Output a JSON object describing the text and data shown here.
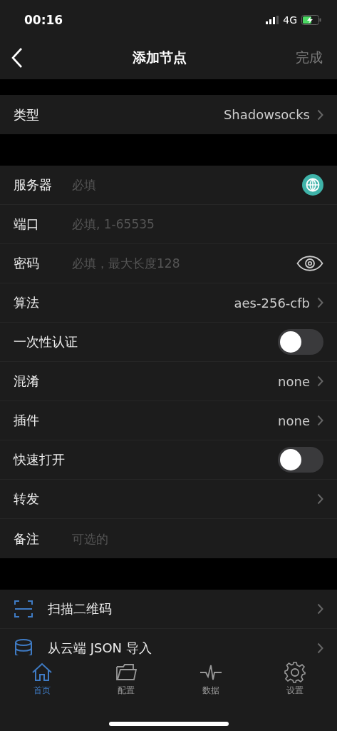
{
  "status_bar": {
    "time": "00:16",
    "network": "4G"
  },
  "nav": {
    "title": "添加节点",
    "done": "完成"
  },
  "type_row": {
    "label": "类型",
    "value": "Shadowsocks"
  },
  "fields": [
    {
      "kind": "lookup",
      "label": "服务器",
      "placeholder": "必填"
    },
    {
      "kind": "input",
      "label": "端口",
      "placeholder": "必填, 1-65535"
    },
    {
      "kind": "secret",
      "label": "密码",
      "placeholder": "必填，最大长度128"
    },
    {
      "kind": "picker",
      "label": "算法",
      "value": "aes-256-cfb"
    },
    {
      "kind": "toggle",
      "label": "一次性认证",
      "on": false
    },
    {
      "kind": "picker",
      "label": "混淆",
      "value": "none"
    },
    {
      "kind": "picker",
      "label": "插件",
      "value": "none"
    },
    {
      "kind": "toggle",
      "label": "快速打开",
      "on": false
    },
    {
      "kind": "link",
      "label": "转发"
    },
    {
      "kind": "input",
      "label": "备注",
      "placeholder": "可选的"
    }
  ],
  "actions": [
    {
      "kind": "scan",
      "label": "扫描二维码"
    },
    {
      "kind": "cloud",
      "label": "从云端 JSON 导入"
    }
  ],
  "tab_bar": [
    {
      "kind": "home",
      "label": "首页",
      "selected": true
    },
    {
      "kind": "folder",
      "label": "配置",
      "selected": false
    },
    {
      "kind": "pulse",
      "label": "数据",
      "selected": false
    },
    {
      "kind": "gear",
      "label": "设置",
      "selected": false
    }
  ]
}
